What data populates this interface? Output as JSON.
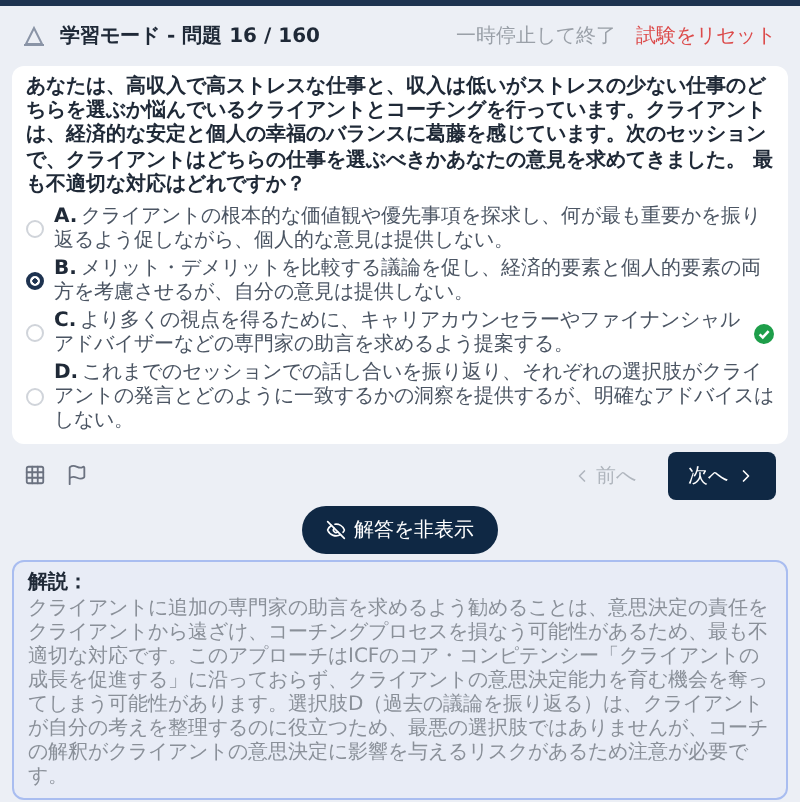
{
  "header": {
    "title": "学習モード - 問題 16 / 160",
    "pause": "一時停止して終了",
    "reset": "試験をリセット"
  },
  "question": "あなたは、高収入で高ストレスな仕事と、収入は低いがストレスの少ない仕事のどちらを選ぶか悩んでいるクライアントとコーチングを行っています。クライアントは、経済的な安定と個人の幸福のバランスに葛藤を感じています。次のセッションで、クライアントはどちらの仕事を選ぶべきかあなたの意見を求めてきました。 最も不適切な対応はどれですか？",
  "options": [
    {
      "letter": "A.",
      "text": "クライアントの根本的な価値観や優先事項を探求し、何が最も重要かを振り返るよう促しながら、個人的な意見は提供しない。",
      "selected": false,
      "correct": false
    },
    {
      "letter": "B.",
      "text": "メリット・デメリットを比較する議論を促し、経済的要素と個人的要素の両方を考慮させるが、自分の意見は提供しない。",
      "selected": true,
      "correct": false
    },
    {
      "letter": "C.",
      "text": "より多くの視点を得るために、キャリアカウンセラーやファイナンシャルアドバイザーなどの専門家の助言を求めるよう提案する。",
      "selected": false,
      "correct": true
    },
    {
      "letter": "D.",
      "text": "これまでのセッションでの話し合いを振り返り、それぞれの選択肢がクライアントの発言とどのように一致するかの洞察を提供するが、明確なアドバイスはしない。",
      "selected": false,
      "correct": false
    }
  ],
  "nav": {
    "prev": {
      "label": "前へ",
      "disabled": true
    },
    "next": {
      "label": "次へ",
      "disabled": false
    }
  },
  "toggle_answer": "解答を非表示",
  "explanation": {
    "title": "解説：",
    "body": "クライアントに追加の専門家の助言を求めるよう勧めることは、意思決定の責任をクライアントから遠ざけ、コーチングプロセスを損なう可能性があるため、最も不適切な対応です。このアプローチはICFのコア・コンピテンシー「クライアントの成長を促進する」に沿っておらず、クライアントの意思決定能力を育む機会を奪ってしまう可能性があります。選択肢D（過去の議論を振り返る）は、クライアントが自分の考えを整理するのに役立つため、最悪の選択肢ではありませんが、コーチの解釈がクライアントの意思決定に影響を与えるリスクがあるため注意が必要です。"
  }
}
